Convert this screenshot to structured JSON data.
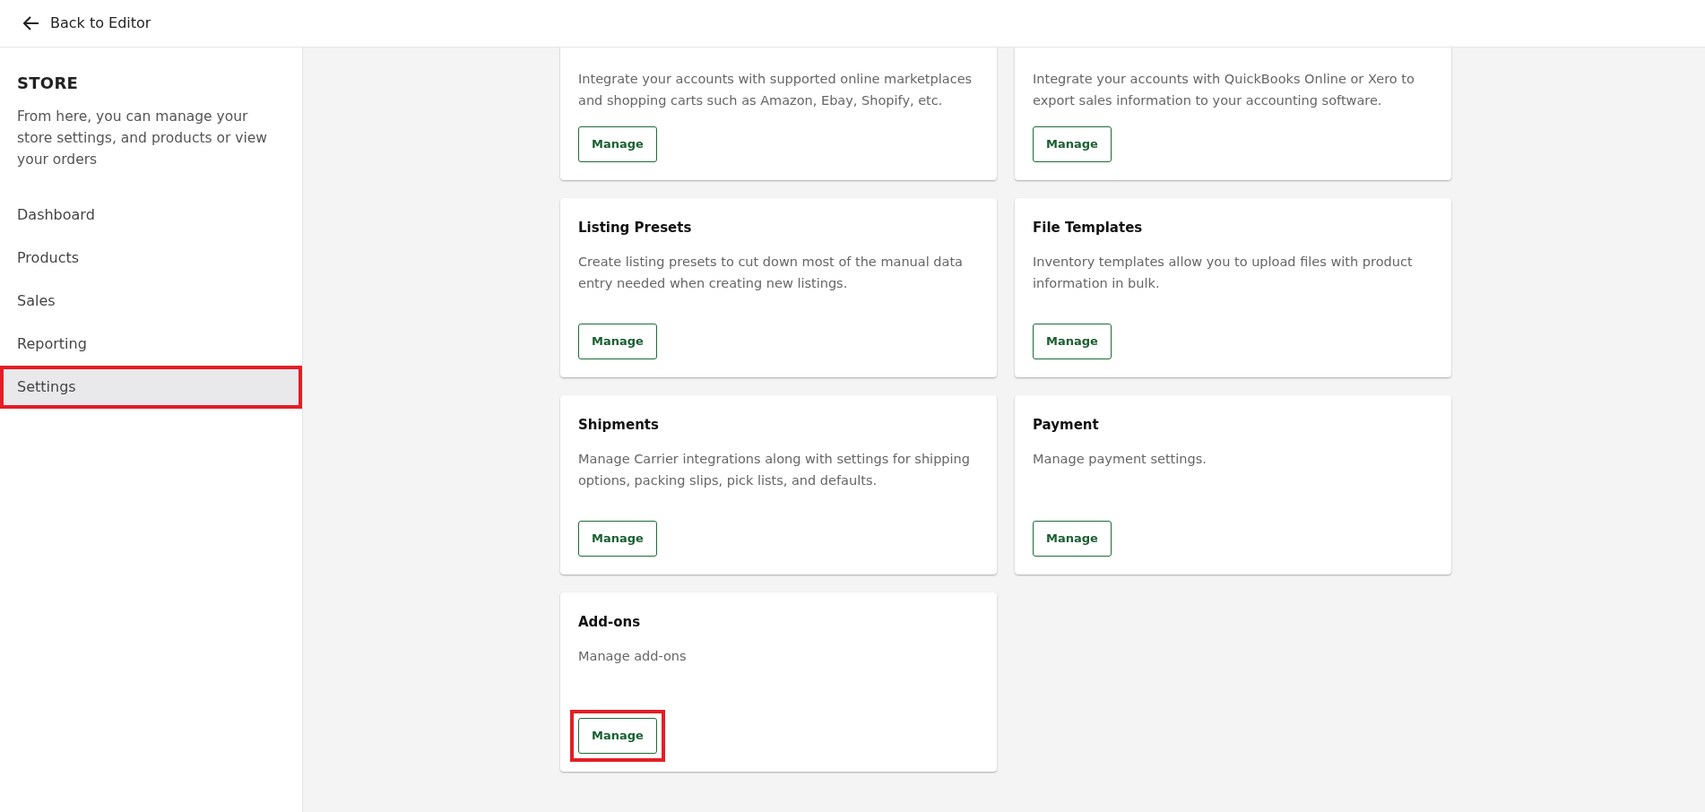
{
  "top_bar": {
    "back_link": "Back to Editor"
  },
  "sidebar": {
    "title": "STORE",
    "description": "From here, you can manage your store settings, and products or view your orders",
    "items": [
      {
        "label": "Dashboard",
        "selected": false,
        "highlighted": false
      },
      {
        "label": "Products",
        "selected": false,
        "highlighted": false
      },
      {
        "label": "Sales",
        "selected": false,
        "highlighted": false
      },
      {
        "label": "Reporting",
        "selected": false,
        "highlighted": false
      },
      {
        "label": "Settings",
        "selected": true,
        "highlighted": true
      }
    ]
  },
  "cards": [
    {
      "description": "Integrate your accounts with supported online marketplaces and shopping carts such as Amazon, Ebay, Shopify, etc.",
      "button": {
        "label": "Manage",
        "highlighted": false
      }
    },
    {
      "description": "Integrate your accounts with QuickBooks Online or Xero to export sales information to your accounting software.",
      "button": {
        "label": "Manage",
        "highlighted": false
      }
    },
    {
      "title": "Listing Presets",
      "description": "Create listing presets to cut down most of the manual data entry needed when creating new listings.",
      "button": {
        "label": "Manage",
        "highlighted": false
      }
    },
    {
      "title": "File Templates",
      "description": "Inventory templates allow you to upload files with product information in bulk.",
      "button": {
        "label": "Manage",
        "highlighted": false
      }
    },
    {
      "title": "Shipments",
      "description": "Manage Carrier integrations along with settings for shipping options, packing slips, pick lists, and defaults.",
      "button": {
        "label": "Manage",
        "highlighted": false
      }
    },
    {
      "title": "Payment",
      "description": "Manage payment settings.",
      "button": {
        "label": "Manage",
        "highlighted": false
      }
    },
    {
      "title": "Add-ons",
      "description": "Manage add-ons",
      "button": {
        "label": "Manage",
        "highlighted": true
      }
    }
  ]
}
